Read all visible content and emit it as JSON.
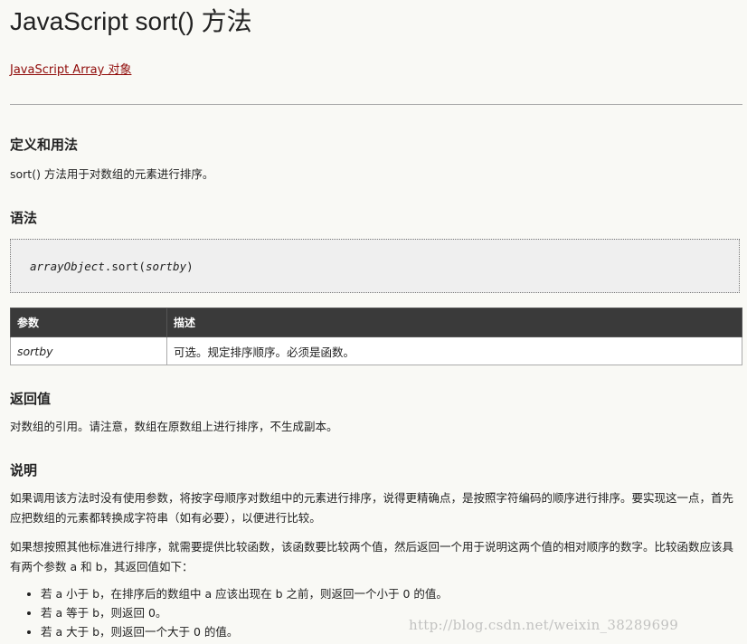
{
  "title": "JavaScript sort() 方法",
  "back_link": "JavaScript Array 对象",
  "sections": {
    "definition": {
      "heading": "定义和用法",
      "text": "sort() 方法用于对数组的元素进行排序。"
    },
    "syntax": {
      "heading": "语法",
      "code_object": "arrayObject",
      "code_method": ".sort(",
      "code_param": "sortby",
      "code_close": ")"
    },
    "params_table": {
      "headers": [
        "参数",
        "描述"
      ],
      "rows": [
        {
          "name": "sortby",
          "desc": "可选。规定排序顺序。必须是函数。"
        }
      ]
    },
    "return_value": {
      "heading": "返回值",
      "text": "对数组的引用。请注意，数组在原数组上进行排序，不生成副本。"
    },
    "description": {
      "heading": "说明",
      "para1": "如果调用该方法时没有使用参数，将按字母顺序对数组中的元素进行排序，说得更精确点，是按照字符编码的顺序进行排序。要实现这一点，首先应把数组的元素都转换成字符串（如有必要），以便进行比较。",
      "para2": "如果想按照其他标准进行排序，就需要提供比较函数，该函数要比较两个值，然后返回一个用于说明这两个值的相对顺序的数字。比较函数应该具有两个参数 a 和 b，其返回值如下：",
      "rules": [
        "若 a 小于 b，在排序后的数组中 a 应该出现在 b 之前，则返回一个小于 0 的值。",
        "若 a 等于 b，则返回 0。",
        "若 a 大于 b，则返回一个大于 0 的值。"
      ]
    }
  },
  "watermark": "http://blog.csdn.net/weixin_38289699",
  "colors": {
    "background": "#f9f9f5",
    "link": "#900b09",
    "table_header": "#3a3a3a",
    "code_background": "#efefef"
  }
}
